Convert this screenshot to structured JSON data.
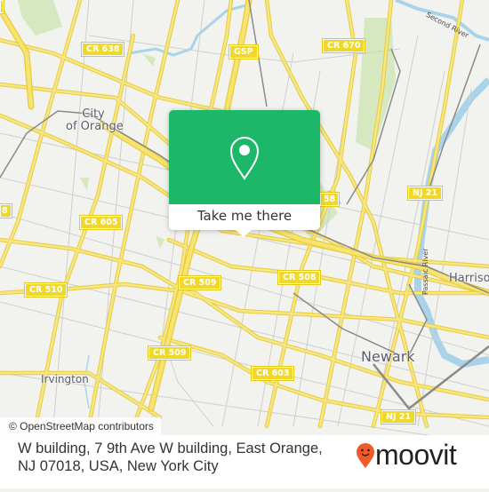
{
  "map": {
    "road_shields": [
      {
        "id": "cr638",
        "label": "CR 638"
      },
      {
        "id": "gsp",
        "label": "GSP"
      },
      {
        "id": "cr670",
        "label": "CR 670"
      },
      {
        "id": "edge-left",
        "label": "8"
      },
      {
        "id": "cr605",
        "label": "CR 605"
      },
      {
        "id": "cr658",
        "label": "58"
      },
      {
        "id": "nj21-top",
        "label": "NJ 21"
      },
      {
        "id": "cr510",
        "label": "CR 510"
      },
      {
        "id": "cr509-a",
        "label": "CR 509"
      },
      {
        "id": "cr508",
        "label": "CR 508"
      },
      {
        "id": "cr509-b",
        "label": "CR 509"
      },
      {
        "id": "cr603",
        "label": "CR 603"
      },
      {
        "id": "nj21-bottom",
        "label": "NJ 21"
      },
      {
        "id": "edge-topleft",
        "label": ""
      }
    ],
    "places": {
      "city_of_orange_line1": "City",
      "city_of_orange_line2": "of Orange",
      "irvington": "Irvington",
      "newark": "Newark",
      "harrison": "Harrison"
    },
    "waterways": {
      "second_river": "Second River",
      "passaic_river": "Passaic River"
    },
    "colors": {
      "background": "#f2f2ef",
      "road": "#f5e06a",
      "road_casing": "#e8cc3a",
      "minor_road": "#c9c9c9",
      "water": "#a9d3ea",
      "park": "#d6e8bf",
      "rail": "#888888"
    }
  },
  "popup": {
    "icon": "location-pin-icon",
    "button_label": "Take me there",
    "accent_color": "#1db76a"
  },
  "attribution": "© OpenStreetMap contributors",
  "footer": {
    "address": "W building, 7 9th Ave W building, East Orange, NJ 07018, USA, New York City",
    "brand_name": "moovit",
    "brand_icon": "moovit-smiley-pin-icon",
    "brand_color": "#f05a28"
  }
}
